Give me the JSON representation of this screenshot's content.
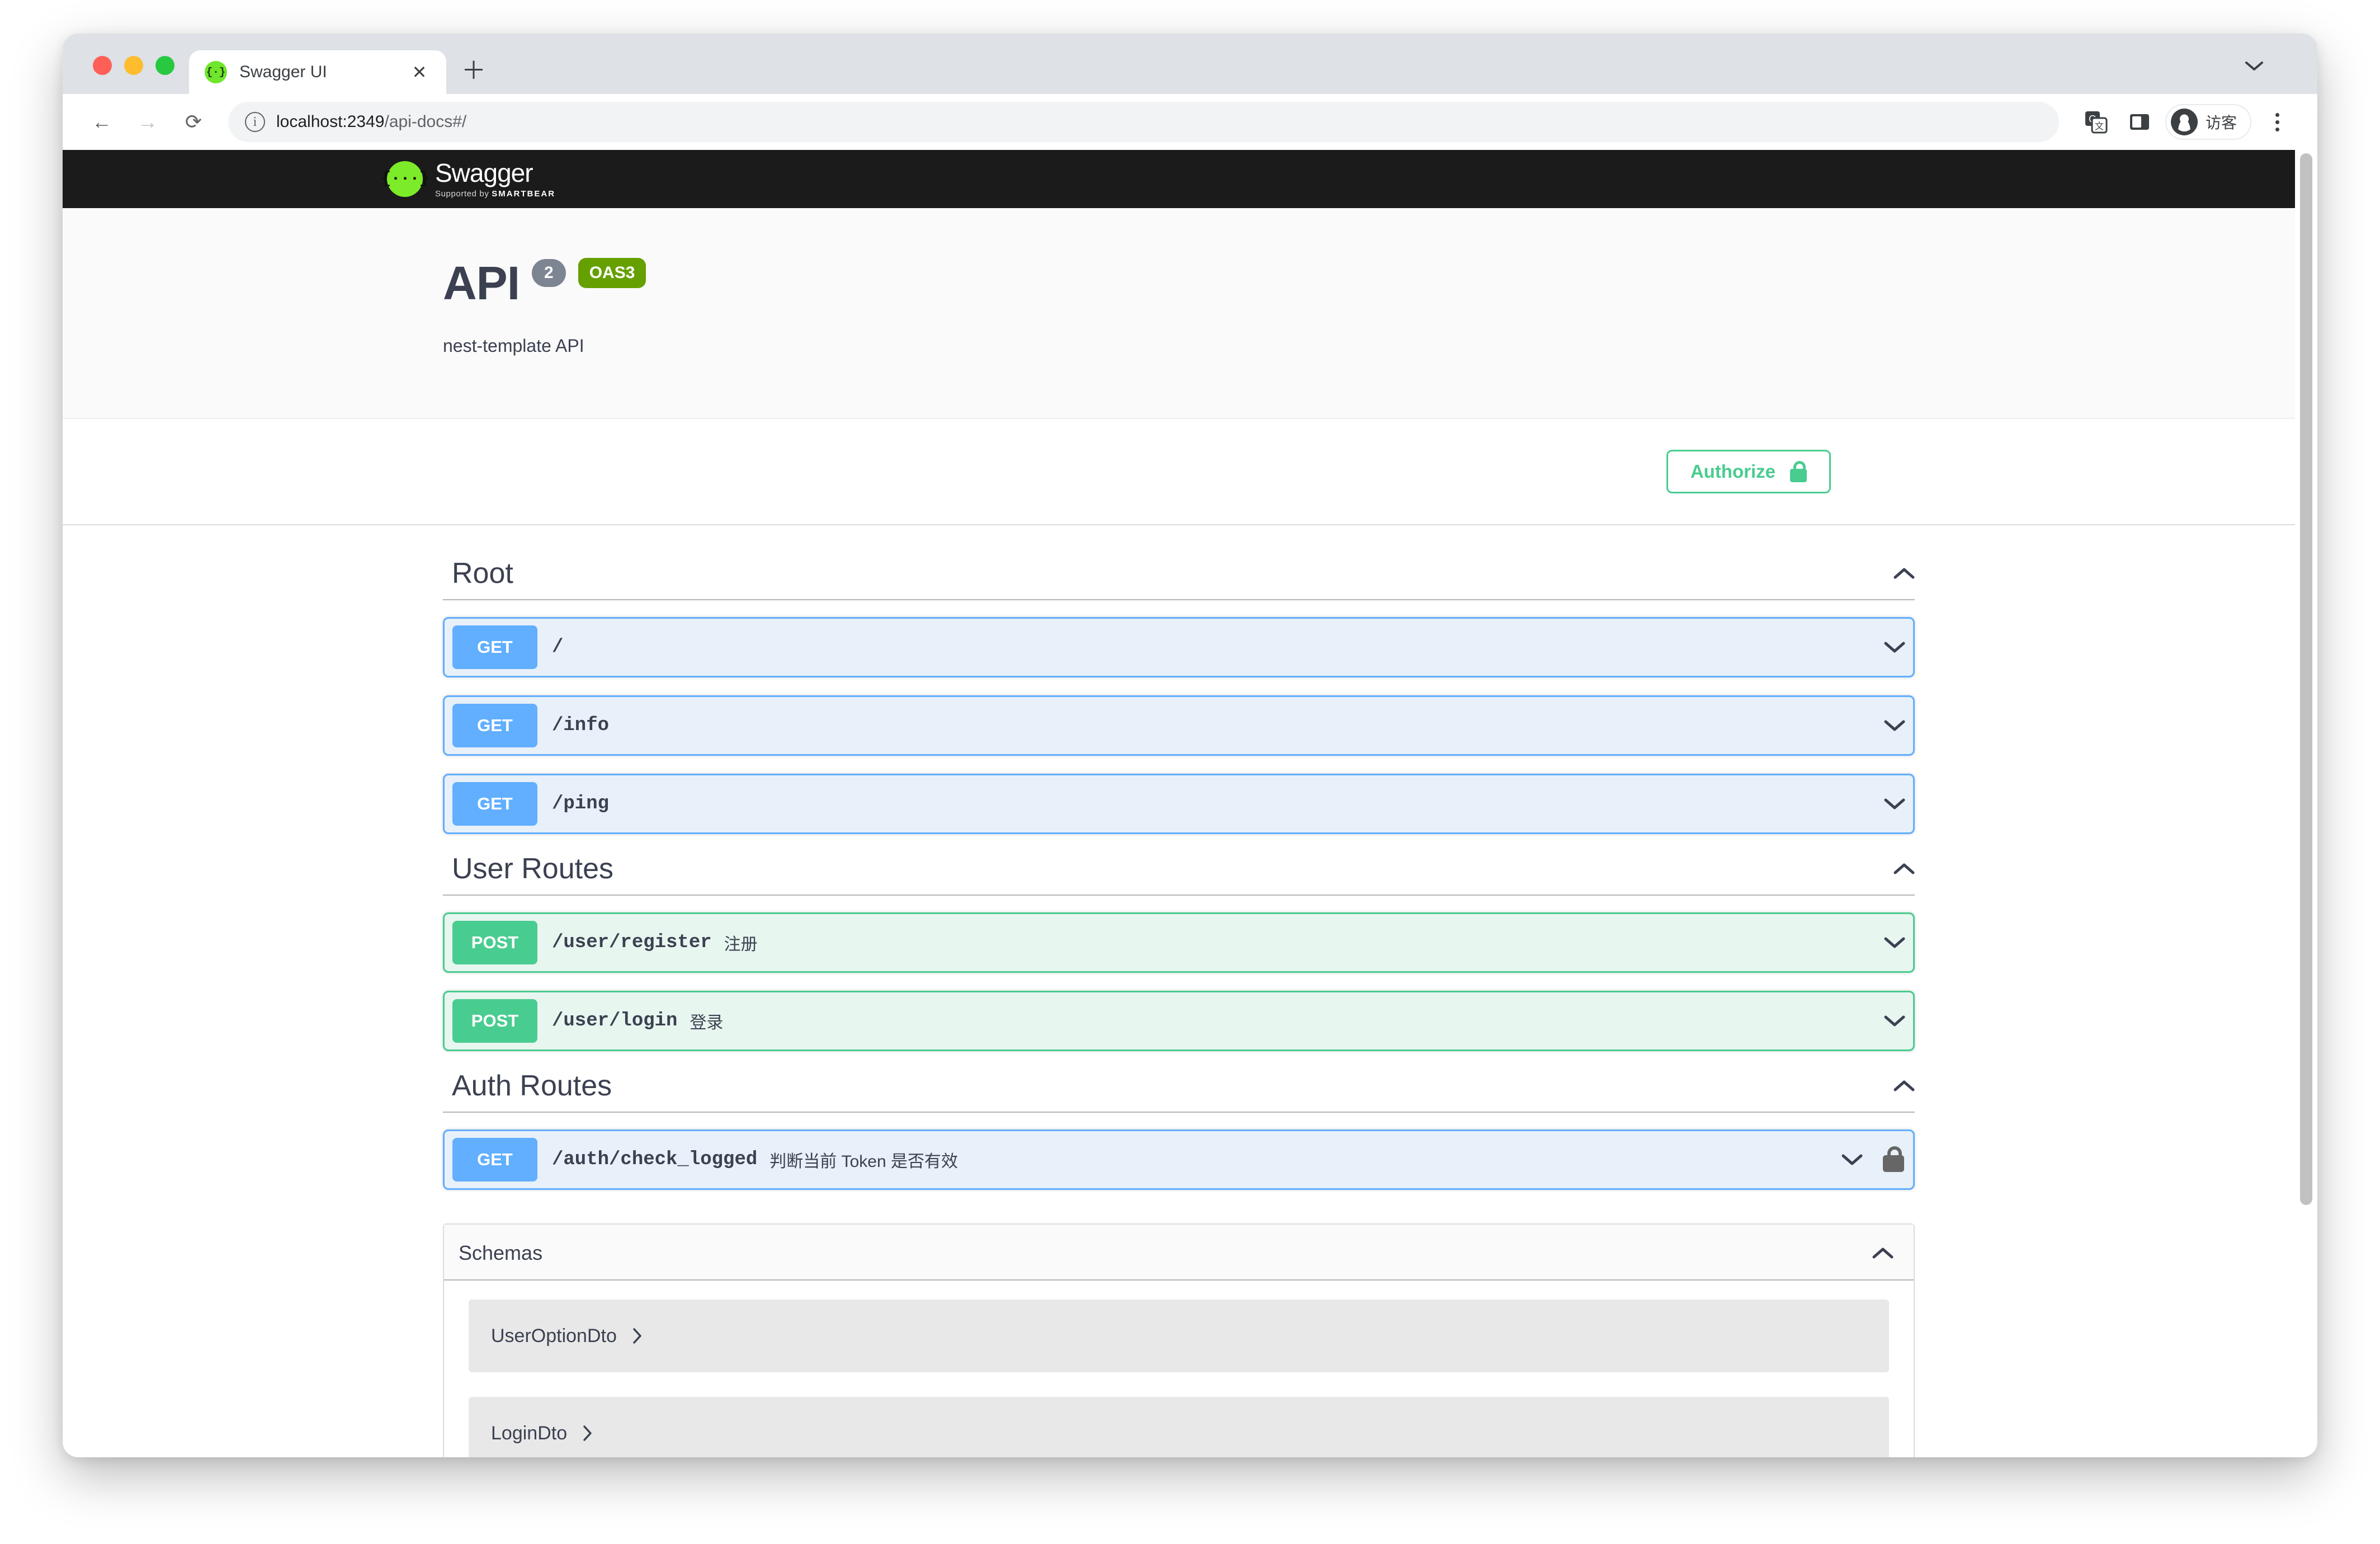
{
  "browser": {
    "tab": {
      "title": "Swagger UI",
      "favicon_glyph": "{·}",
      "close_label": "✕"
    },
    "newtab_label": "＋",
    "tablist_chevron": "chevron-down",
    "nav": {
      "back": "←",
      "forward": "→",
      "reload": "⟳"
    },
    "omnibox": {
      "info_label": "ⓘ",
      "url_host": "localhost:2349",
      "url_path": "/api-docs#/"
    },
    "toolbar_right": {
      "translate_label": "G",
      "sidepanel_label": "▯",
      "profile_name": "访客",
      "menu_label": "kebab"
    }
  },
  "swagger": {
    "logo": {
      "mark": "{···}",
      "name": "Swagger",
      "sub_prefix": "Supported by",
      "sub_brand": "SMARTBEAR"
    },
    "info": {
      "title": "API",
      "version_badge": "2",
      "spec_badge": "OAS3",
      "description": "nest-template API"
    },
    "authorize": {
      "label": "Authorize",
      "icon": "lock-open-icon"
    },
    "colors": {
      "get": "#61affe",
      "post": "#49cc90",
      "get_bg": "#e8f0f9",
      "post_bg": "#e8f6f0",
      "authorize": "#49cc90",
      "oas_badge": "#65a000",
      "version_badge": "#7d8492",
      "topbar": "#1b1b1b"
    },
    "sections": [
      {
        "title": "Root",
        "collapse_icon": "chevron-up",
        "operations": [
          {
            "method": "GET",
            "path": "/",
            "summary": "",
            "locked": false,
            "chevron": "chevron-down"
          },
          {
            "method": "GET",
            "path": "/info",
            "summary": "",
            "locked": false,
            "chevron": "chevron-down"
          },
          {
            "method": "GET",
            "path": "/ping",
            "summary": "",
            "locked": false,
            "chevron": "chevron-down"
          }
        ]
      },
      {
        "title": "User Routes",
        "collapse_icon": "chevron-up",
        "operations": [
          {
            "method": "POST",
            "path": "/user/register",
            "summary": "注册",
            "locked": false,
            "chevron": "chevron-down"
          },
          {
            "method": "POST",
            "path": "/user/login",
            "summary": "登录",
            "locked": false,
            "chevron": "chevron-down"
          }
        ]
      },
      {
        "title": "Auth Routes",
        "collapse_icon": "chevron-up",
        "operations": [
          {
            "method": "GET",
            "path": "/auth/check_logged",
            "summary": "判断当前 Token 是否有效",
            "locked": true,
            "chevron": "chevron-down"
          }
        ]
      }
    ],
    "schemas": {
      "title": "Schemas",
      "collapse_icon": "chevron-up",
      "items": [
        {
          "name": "UserOptionDto",
          "chevron": "chevron-right"
        },
        {
          "name": "LoginDto",
          "chevron": "chevron-right"
        }
      ]
    }
  }
}
